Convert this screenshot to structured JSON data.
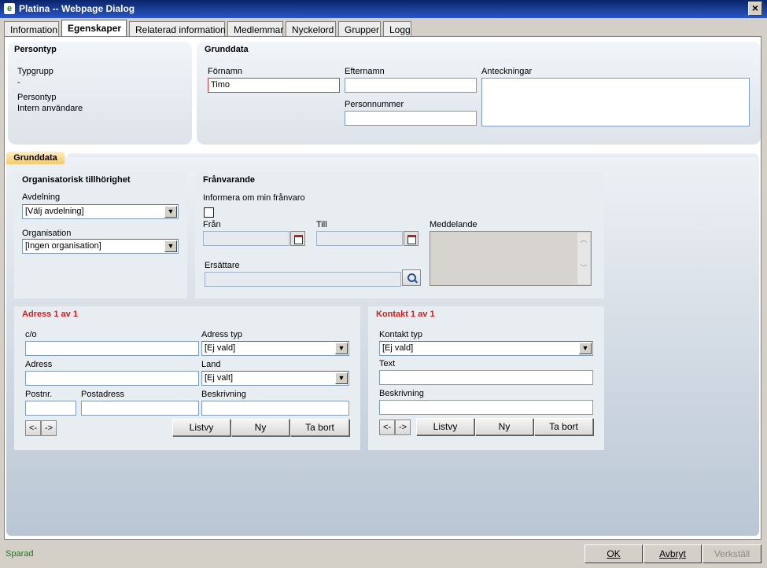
{
  "window": {
    "title": "Platina -- Webpage Dialog",
    "close_glyph": "×",
    "app_icon_glyph": "e"
  },
  "tabs": [
    {
      "label": "Information"
    },
    {
      "label": "Egenskaper",
      "active": true
    },
    {
      "label": "Relaterad information"
    },
    {
      "label": "Medlemmar"
    },
    {
      "label": "Nyckelord"
    },
    {
      "label": "Grupper"
    },
    {
      "label": "Logg"
    }
  ],
  "persontyp": {
    "heading": "Persontyp",
    "typgrupp_label": "Typgrupp",
    "typgrupp_value": "-",
    "persontyp_label": "Persontyp",
    "persontyp_value": "Intern användare"
  },
  "grunddata_header": {
    "heading": "Grunddata",
    "fornamn_label": "Förnamn",
    "fornamn_value": "Timo",
    "efternamn_label": "Efternamn",
    "efternamn_value": "",
    "personnummer_label": "Personnummer",
    "personnummer_value": "",
    "anteckningar_label": "Anteckningar",
    "anteckningar_value": ""
  },
  "subtab": {
    "label": "Grunddata"
  },
  "org": {
    "heading": "Organisatorisk tillhörighet",
    "avdelning_label": "Avdelning",
    "avdelning_value": "[Välj avdelning]",
    "organisation_label": "Organisation",
    "organisation_value": "[Ingen organisation]"
  },
  "franvarande": {
    "heading": "Frånvarande",
    "informera_label": "Informera om min frånvaro",
    "informera_checked": false,
    "fran_label": "Från",
    "till_label": "Till",
    "meddelande_label": "Meddelande",
    "ersattare_label": "Ersättare"
  },
  "adress": {
    "heading": "Adress 1 av 1",
    "co_label": "c/o",
    "adress_typ_label": "Adress typ",
    "adress_typ_value": "[Ej vald]",
    "adress_label": "Adress",
    "land_label": "Land",
    "land_value": "[Ej valt]",
    "postnr_label": "Postnr.",
    "postadress_label": "Postadress",
    "beskrivning_label": "Beskrivning",
    "prev_label": "<-",
    "next_label": "->",
    "listvy_label": "Listvy",
    "ny_label": "Ny",
    "ta_bort_label": "Ta bort"
  },
  "kontakt": {
    "heading": "Kontakt 1 av 1",
    "kontakt_typ_label": "Kontakt typ",
    "kontakt_typ_value": "[Ej vald]",
    "text_label": "Text",
    "beskrivning_label": "Beskrivning",
    "prev_label": "<-",
    "next_label": "->",
    "listvy_label": "Listvy",
    "ny_label": "Ny",
    "ta_bort_label": "Ta bort"
  },
  "status": {
    "text": "Sparad",
    "ok_label": "OK",
    "avbryt_label": "Avbryt",
    "verkstall_label": "Verkställ"
  },
  "colors": {
    "accent": "#0a246a",
    "section_heading_red": "#d41e1e",
    "status_green": "#1a7a1a",
    "subtab_orange": "#f5c96a"
  },
  "icons": {
    "dropdown": "chevron-down-icon",
    "calendar": "calendar-icon",
    "search": "search-icon",
    "close": "close-icon"
  }
}
